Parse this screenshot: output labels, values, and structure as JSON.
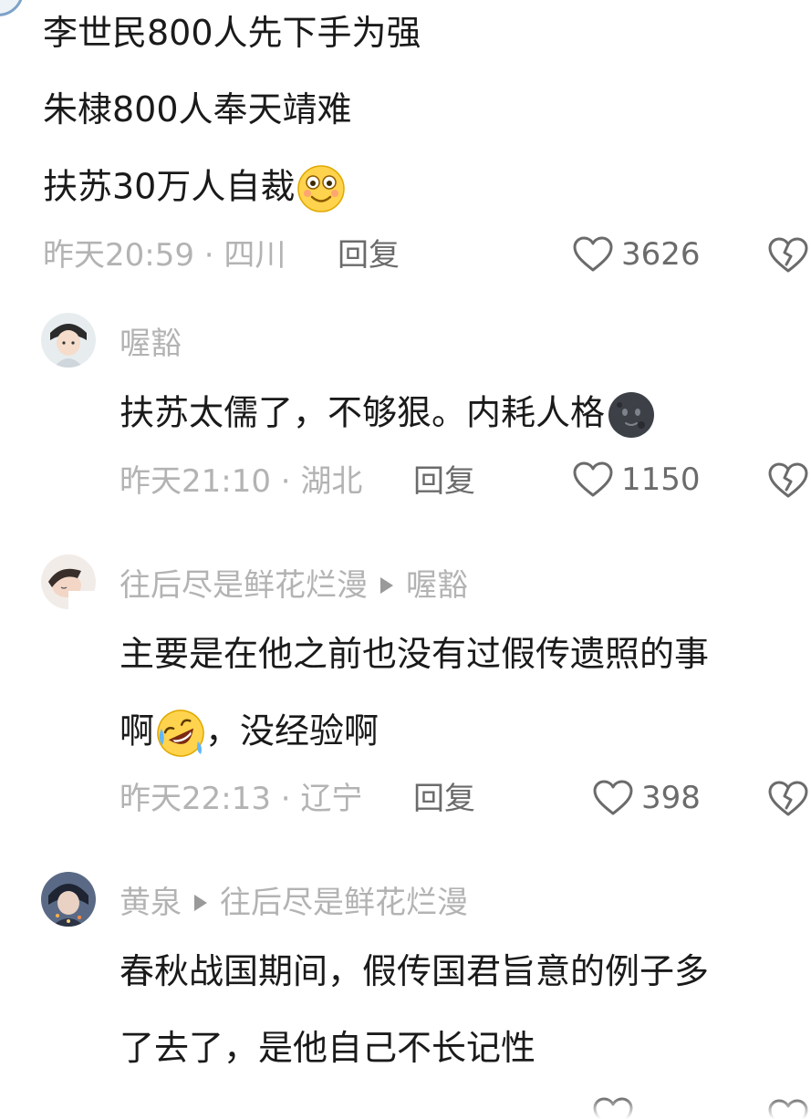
{
  "comment1": {
    "lines": [
      "李世民800人先下手为强",
      "朱棣800人奉天靖难",
      "扶苏30万人自裁"
    ],
    "emoji": "flushed-smile-emoji",
    "meta": "昨天20:59 · 四川",
    "reply": "回复",
    "likes": "3626"
  },
  "comment2": {
    "username": "喔豁",
    "text": "扶苏太儒了，不够狠。内耗人格",
    "emoji": "new-moon-face-emoji",
    "meta": "昨天21:10 · 湖北",
    "reply": "回复",
    "likes": "1150"
  },
  "comment3": {
    "username": "往后尽是鲜花烂漫",
    "reply_to": "喔豁",
    "line1": "主要是在他之前也没有过假传遗照的事",
    "line2_a": "啊",
    "line2_b": "，没经验啊",
    "emoji": "rolling-laughing-emoji",
    "meta": "昨天22:13 · 辽宁",
    "reply": "回复",
    "likes": "398"
  },
  "comment4": {
    "username": "黄泉",
    "reply_to": "往后尽是鲜花烂漫",
    "line1": "春秋战国期间，假传国君旨意的例子多",
    "line2": "了去了，是他自己不长记性"
  },
  "colors": {
    "meta_gray": "#b3b3b3",
    "action_gray": "#6b6b6b",
    "text": "#1a1a1a"
  }
}
